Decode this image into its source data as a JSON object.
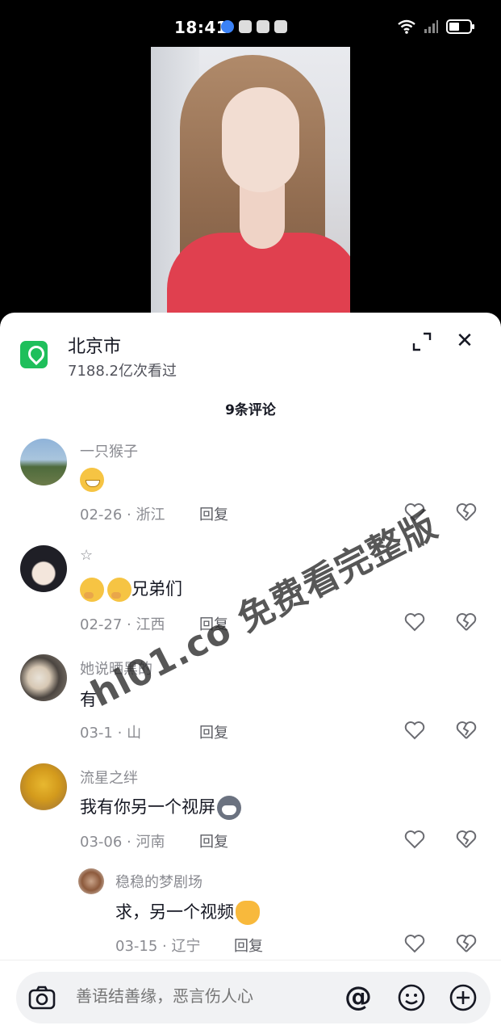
{
  "status_bar": {
    "time": "18:41"
  },
  "location": {
    "name": "北京市",
    "views": "7188.2亿次看过"
  },
  "comment_count": "9条评论",
  "comments": [
    {
      "username": "一只猴子",
      "text": "",
      "emojis": [
        "grin"
      ],
      "date": "02-26",
      "region": "浙江",
      "reply_label": "回复"
    },
    {
      "username": "☆",
      "text": "兄弟们",
      "emojis": [
        "thinking",
        "thinking"
      ],
      "date": "02-27",
      "region": "江西",
      "reply_label": "回复"
    },
    {
      "username": "她说晒黑的",
      "text": "有",
      "emojis": [],
      "date": "03-1",
      "region": "山",
      "reply_label": "回复"
    },
    {
      "username": "流星之绊",
      "text": "我有你另一个视屏",
      "emojis": [
        "dog"
      ],
      "date": "03-06",
      "region": "河南",
      "reply_label": "回复"
    },
    {
      "username": "稳稳的梦剧场",
      "text": "求，另一个视频",
      "emojis": [
        "clap"
      ],
      "date": "03-15",
      "region": "辽宁",
      "reply_label": "回复"
    }
  ],
  "separator": "·",
  "watermark": "hl01.co 免费看完整版",
  "input": {
    "placeholder": "善语结善缘，恶言伤人心",
    "at_label": "@"
  },
  "colors": {
    "location_green": "#1fbf5b",
    "text_primary": "#161823",
    "text_secondary": "#8a8b91"
  }
}
